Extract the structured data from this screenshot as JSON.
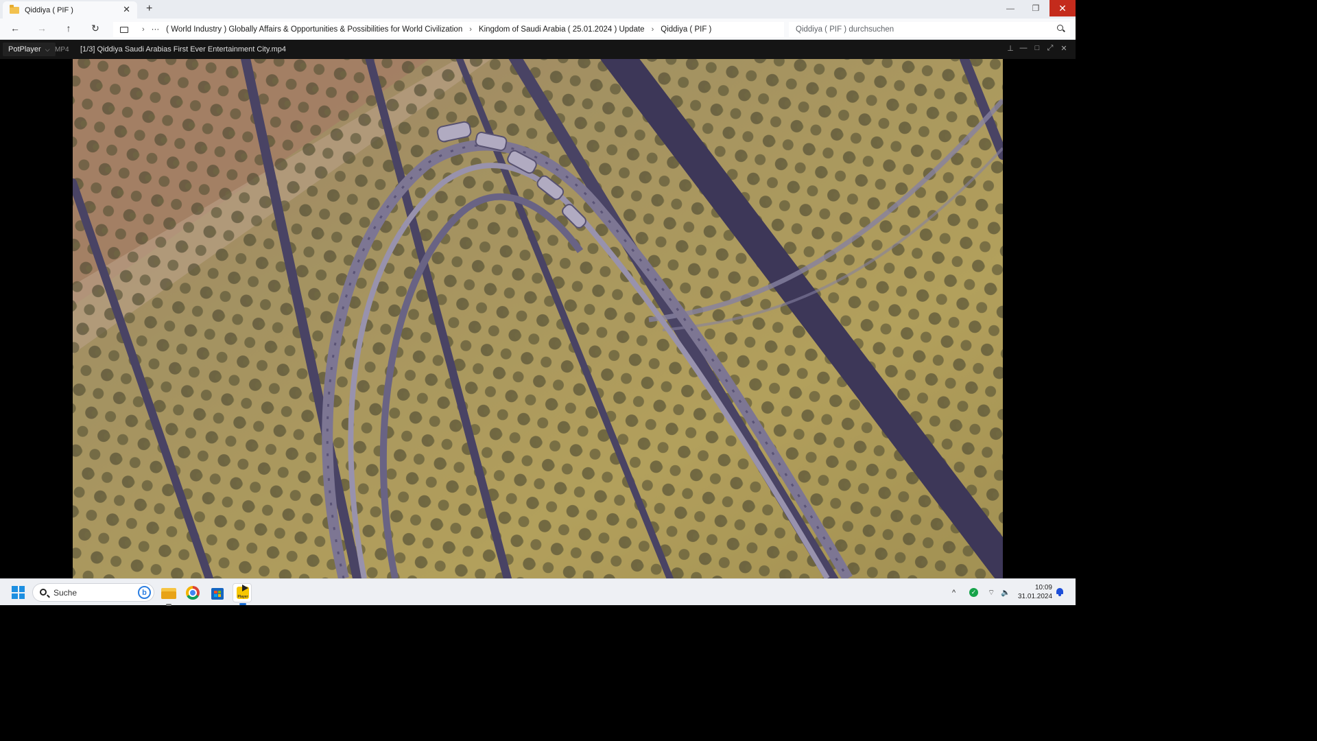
{
  "explorer": {
    "tab_title": "Qiddiya ( PIF )",
    "tab_close": "✕",
    "new_tab": "+",
    "window_controls": {
      "minimize": "—",
      "maximize": "❐",
      "close": "✕"
    },
    "nav": {
      "back": "←",
      "forward": "→",
      "up": "↑",
      "refresh": "↻"
    },
    "breadcrumb_more": "···",
    "breadcrumb_separator": "›",
    "breadcrumb": [
      "( World Industry ) Globally Affairs & Opportunities & Possibilities for World Civilization",
      "Kingdom of Saudi Arabia ( 25.01.2024 ) Update",
      "Qiddiya ( PIF )"
    ],
    "search_placeholder": "Qiddiya ( PIF ) durchsuchen"
  },
  "player": {
    "logo": "PotPlayer",
    "logo_caret": "⌵",
    "format": "MP4",
    "title": "[1/3] Qiddiya  Saudi Arabias First Ever Entertainment City.mp4",
    "controls": {
      "pin": "⊥",
      "minimize": "—",
      "maximize": "□",
      "fullscreen": "⤢",
      "close": "✕"
    }
  },
  "taskbar": {
    "search_label": "Suche",
    "bing": "b",
    "pot_label": "Player",
    "tray_chevron": "^",
    "tray_shield": "✓",
    "tray_wifi": "⌔",
    "tray_volume": "🔈",
    "time": "10:09",
    "date": "31.01.2024"
  },
  "icons": {
    "tab": "folder-icon",
    "breadcrumb_root": "computer-icon",
    "search": "search-icon",
    "start": "windows-logo-icon",
    "explorer": "file-explorer-icon",
    "chrome": "chrome-icon",
    "store": "microsoft-store-icon",
    "potplayer": "potplayer-icon",
    "defender": "defender-shield-icon",
    "wifi": "wifi-icon",
    "volume": "volume-icon",
    "notifications": "notification-bell-icon"
  },
  "colors": {
    "close_red": "#c42b1c",
    "start_blue": "#1d8fe1",
    "defender_green": "#16a34a",
    "sand": "#b19a52",
    "track": "#7b7390"
  }
}
